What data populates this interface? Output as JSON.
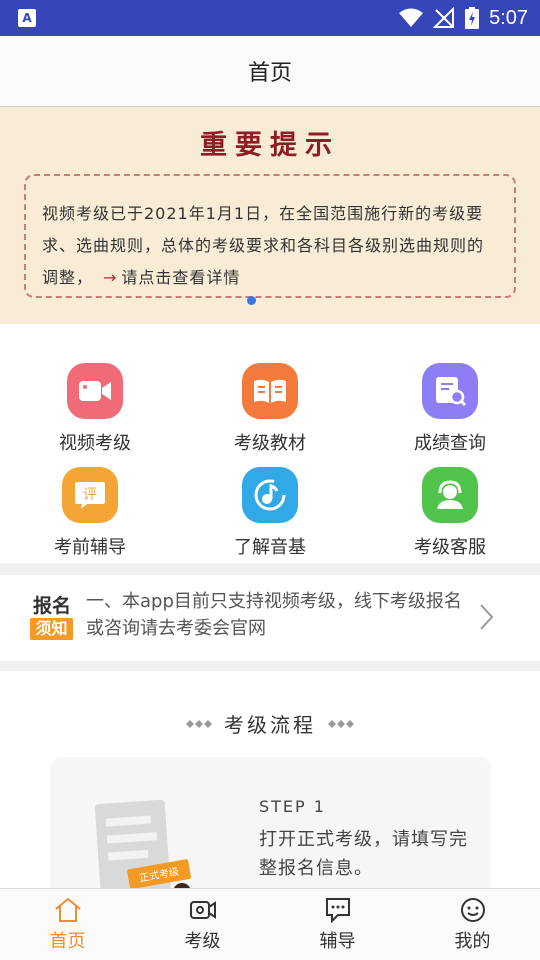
{
  "status_bar": {
    "app_icon_letter": "A",
    "time": "5:07"
  },
  "header": {
    "title": "首页"
  },
  "banner": {
    "title": "重要提示",
    "text_before_link": "视频考级已于2021年1月1日，在全国范围施行新的考级要求、选曲规则，总体的考级要求和各科目各级别选曲规则的调整，",
    "arrow": "→",
    "link_text": "请点击查看详情"
  },
  "features": [
    {
      "label": "视频考级",
      "icon": "video-camera-icon",
      "color": "#f06a78"
    },
    {
      "label": "考级教材",
      "icon": "open-book-icon",
      "color": "#f47a3c"
    },
    {
      "label": "成绩查询",
      "icon": "search-document-icon",
      "color": "#8d7ef5"
    },
    {
      "label": "考前辅导",
      "icon": "comment-ping-icon",
      "color": "#f4a536",
      "glyph": "评"
    },
    {
      "label": "了解音基",
      "icon": "music-note-icon",
      "color": "#31a9e6"
    },
    {
      "label": "考级客服",
      "icon": "customer-service-icon",
      "color": "#4fc34a"
    }
  ],
  "notice": {
    "badge_top": "报名",
    "badge_bottom": "须知",
    "text": "一、本app目前只支持视频考级，线下考级报名或咨询请去考委会官网"
  },
  "process": {
    "title": "考级流程",
    "step_label": "STEP 1",
    "step_text": "打开正式考级，请填写完整报名信息。",
    "illustration_tag": "正式考级"
  },
  "bottom_nav": [
    {
      "label": "首页",
      "icon": "home-icon",
      "active": true
    },
    {
      "label": "考级",
      "icon": "video-icon",
      "active": false
    },
    {
      "label": "辅导",
      "icon": "chat-bubble-icon",
      "active": false
    },
    {
      "label": "我的",
      "icon": "smiley-icon",
      "active": false
    }
  ],
  "colors": {
    "status_bar": "#3646b8",
    "accent": "#f08d2d",
    "banner_bg": "#f8ecd6",
    "banner_title": "#8f1d25"
  }
}
